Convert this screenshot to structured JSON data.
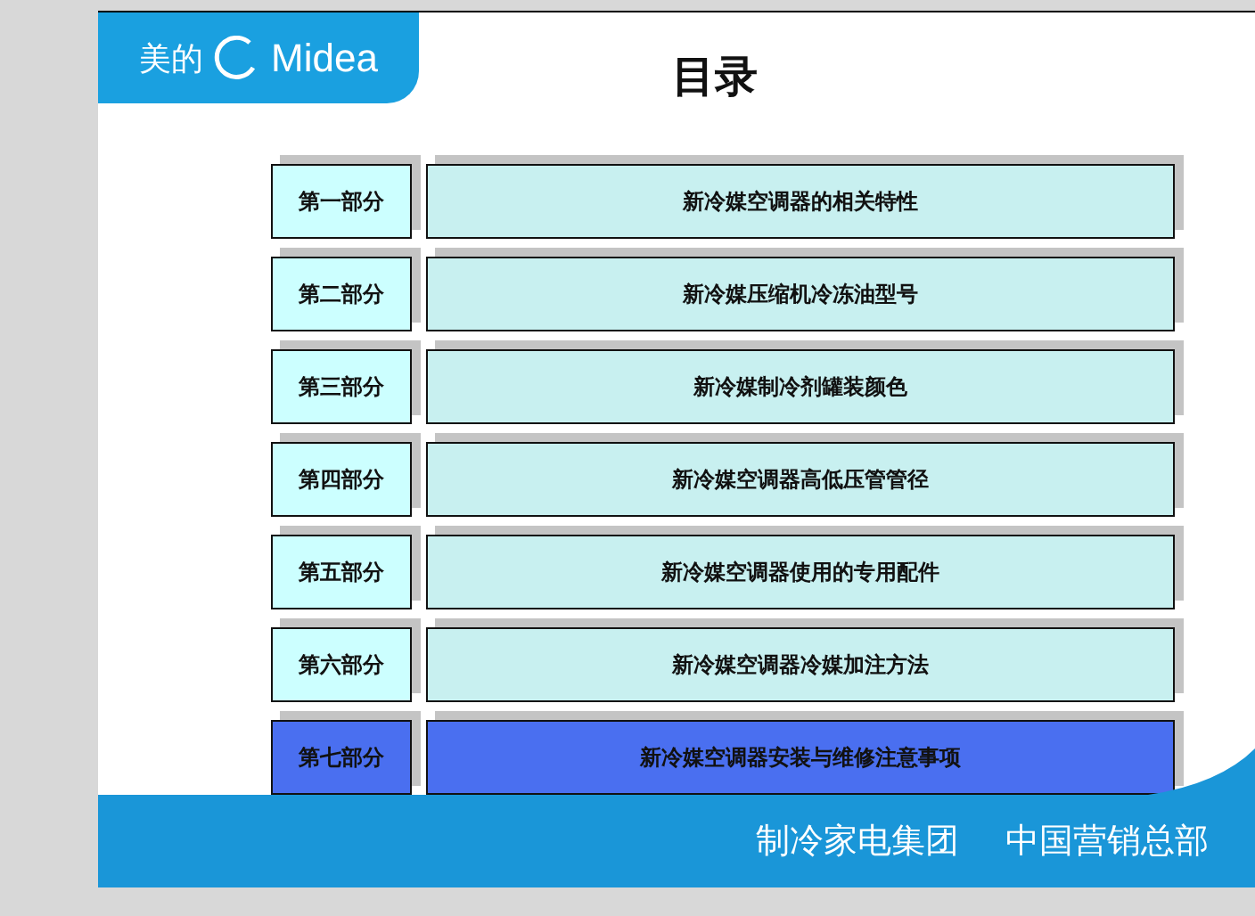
{
  "logo": {
    "text_cn": "美的",
    "text_en": "Midea"
  },
  "title": "目录",
  "sections": [
    {
      "part": "第一部分",
      "topic": "新冷媒空调器的相关特性",
      "selected": false
    },
    {
      "part": "第二部分",
      "topic": "新冷媒压缩机冷冻油型号",
      "selected": false
    },
    {
      "part": "第三部分",
      "topic": "新冷媒制冷剂罐装颜色",
      "selected": false
    },
    {
      "part": "第四部分",
      "topic": "新冷媒空调器高低压管管径",
      "selected": false
    },
    {
      "part": "第五部分",
      "topic": "新冷媒空调器使用的专用配件",
      "selected": false
    },
    {
      "part": "第六部分",
      "topic": "新冷媒空调器冷媒加注方法",
      "selected": false
    },
    {
      "part": "第七部分",
      "topic": "新冷媒空调器安装与维修注意事项",
      "selected": true
    }
  ],
  "footer": {
    "group": "制冷家电集团",
    "division": "中国营销总部"
  }
}
